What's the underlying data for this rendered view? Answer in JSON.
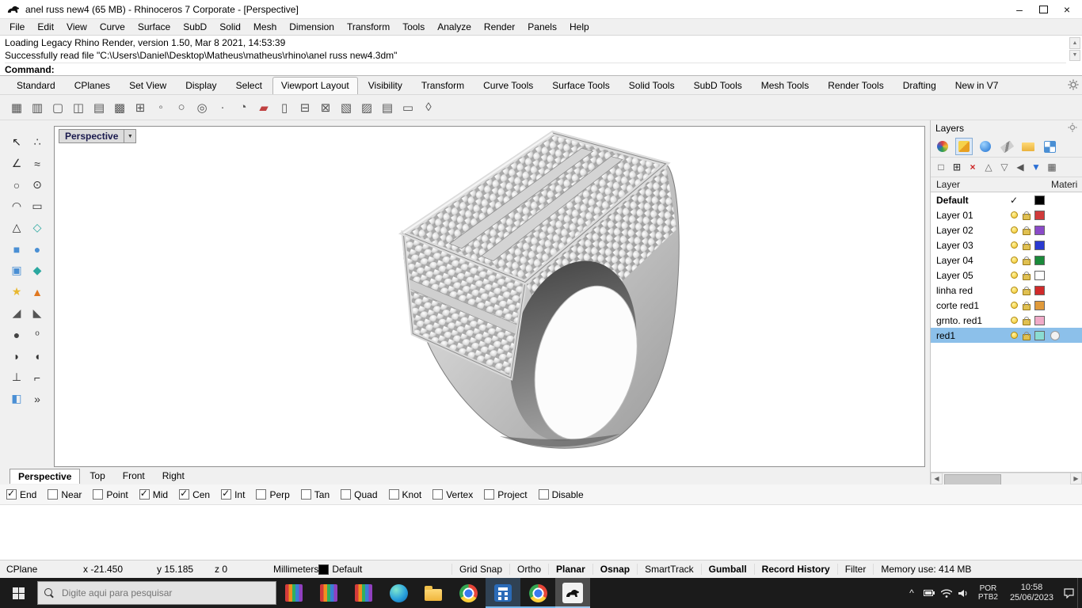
{
  "window": {
    "title": "anel russ new4 (65 MB) - Rhinoceros 7 Corporate - [Perspective]"
  },
  "menu": {
    "items": [
      "File",
      "Edit",
      "View",
      "Curve",
      "Surface",
      "SubD",
      "Solid",
      "Mesh",
      "Dimension",
      "Transform",
      "Tools",
      "Analyze",
      "Render",
      "Panels",
      "Help"
    ]
  },
  "command": {
    "history": [
      "Loading Legacy Rhino Render, version 1.50, Mar  8 2021, 14:53:39",
      "Successfully read file \"C:\\Users\\Daniel\\Desktop\\Matheus\\matheus\\rhino\\anel russ new4.3dm\""
    ],
    "prompt": "Command:"
  },
  "tabs": {
    "items": [
      {
        "label": "Standard"
      },
      {
        "label": "CPlanes"
      },
      {
        "label": "Set View"
      },
      {
        "label": "Display"
      },
      {
        "label": "Select"
      },
      {
        "label": "Viewport Layout",
        "cls": "active"
      },
      {
        "label": "Visibility"
      },
      {
        "label": "Transform"
      },
      {
        "label": "Curve Tools"
      },
      {
        "label": "Surface Tools"
      },
      {
        "label": "Solid Tools"
      },
      {
        "label": "SubD Tools"
      },
      {
        "label": "Mesh Tools"
      },
      {
        "label": "Render Tools"
      },
      {
        "label": "Drafting"
      },
      {
        "label": "New in V7"
      }
    ]
  },
  "toolbar": {
    "icons": [
      {
        "name": "four-viewports-icon",
        "glyph": "▦"
      },
      {
        "name": "viewport-layout-icon",
        "glyph": "▥"
      },
      {
        "name": "single-viewport-icon",
        "glyph": "▢"
      },
      {
        "name": "split-viewport-icon",
        "glyph": "◫"
      },
      {
        "name": "viewport-list-icon",
        "glyph": "▤"
      },
      {
        "name": "viewport-grid-icon",
        "glyph": "▩"
      },
      {
        "name": "new-viewport-icon",
        "glyph": "⊞"
      },
      {
        "name": "point-grid-icon",
        "glyph": "◦"
      },
      {
        "name": "circle-tool-icon",
        "glyph": "○"
      },
      {
        "name": "osnap-circle-icon",
        "glyph": "◎"
      },
      {
        "name": "dot-icon",
        "glyph": "·"
      },
      {
        "name": "shaded-display-icon",
        "glyph": "◔"
      },
      {
        "name": "color-swatch-icon",
        "glyph": "▰",
        "color": "#c04040"
      },
      {
        "name": "page-layout-icon",
        "glyph": "▯"
      },
      {
        "name": "section-view-icon",
        "glyph": "⊟"
      },
      {
        "name": "table-icon",
        "glyph": "⊠"
      },
      {
        "name": "hatch-icon",
        "glyph": "▧"
      },
      {
        "name": "ramp-icon",
        "glyph": "▨"
      },
      {
        "name": "printer-icon",
        "glyph": "▤"
      },
      {
        "name": "frame-icon",
        "glyph": "▭"
      },
      {
        "name": "lock-viewport-icon",
        "glyph": "◊"
      }
    ]
  },
  "tool_palette": {
    "tools": [
      {
        "name": "select-pointer-icon",
        "glyph": "↖",
        "color": "#222222"
      },
      {
        "name": "control-points-icon",
        "glyph": "∴",
        "color": "#444444"
      },
      {
        "name": "polyline-icon",
        "glyph": "∠",
        "color": "#333333"
      },
      {
        "name": "freeform-curve-icon",
        "glyph": "≈",
        "color": "#333333"
      },
      {
        "name": "circle-icon",
        "glyph": "○",
        "color": "#333333"
      },
      {
        "name": "ellipse-icon",
        "glyph": "⊙",
        "color": "#333333"
      },
      {
        "name": "arc-icon",
        "glyph": "◠",
        "color": "#333333"
      },
      {
        "name": "rectangle-icon",
        "glyph": "▭",
        "color": "#333333"
      },
      {
        "name": "polygon-icon",
        "glyph": "△",
        "color": "#333333"
      },
      {
        "name": "curve-tools-icon",
        "glyph": "◇",
        "color": "#2ba8a0"
      },
      {
        "name": "surface-icon",
        "glyph": "■",
        "color": "#4a8fd4"
      },
      {
        "name": "sphere-icon",
        "glyph": "●",
        "color": "#4a8fd4"
      },
      {
        "name": "box-icon",
        "glyph": "▣",
        "color": "#4a8fd4"
      },
      {
        "name": "solid-tools-icon",
        "glyph": "◆",
        "color": "#2ba8a0"
      },
      {
        "name": "explode-icon",
        "glyph": "★",
        "color": "#e8b830"
      },
      {
        "name": "fillet-icon",
        "glyph": "▲",
        "color": "#e07820"
      },
      {
        "name": "trim-icon",
        "glyph": "◢",
        "color": "#555555"
      },
      {
        "name": "split-icon",
        "glyph": "◣",
        "color": "#555555"
      },
      {
        "name": "shade-sphere-icon",
        "glyph": "●",
        "color": "#444444"
      },
      {
        "name": "point-cloud-icon",
        "glyph": "º",
        "color": "#555555"
      },
      {
        "name": "curve-boolean-icon",
        "glyph": "◗",
        "color": "#333333"
      },
      {
        "name": "arc-blend-icon",
        "glyph": "◖",
        "color": "#333333"
      },
      {
        "name": "cplane-icon",
        "glyph": "⊥",
        "color": "#333333"
      },
      {
        "name": "move-icon",
        "glyph": "⌐",
        "color": "#333333"
      },
      {
        "name": "gumball-icon",
        "glyph": "◧",
        "color": "#4a8fd4"
      },
      {
        "name": "more-tools-chevron-icon",
        "glyph": "»",
        "color": "#333333"
      }
    ]
  },
  "viewport": {
    "label": "Perspective",
    "tabs": [
      {
        "label": "Perspective",
        "cls": "active"
      },
      {
        "label": "Top"
      },
      {
        "label": "Front"
      },
      {
        "label": "Right"
      }
    ]
  },
  "layers_panel": {
    "title": "Layers",
    "columns": {
      "layer": "Layer",
      "material": "Materi"
    },
    "panel_tabs": [
      {
        "name": "properties-icon",
        "kind": "pt-ball"
      },
      {
        "name": "layers-tab-icon",
        "kind": "pt-layers",
        "cls": "active"
      },
      {
        "name": "display-icon",
        "kind": "pt-display"
      },
      {
        "name": "match-properties-icon",
        "kind": "pt-match"
      },
      {
        "name": "libraries-icon",
        "kind": "pt-folder"
      },
      {
        "name": "rendering-icon",
        "kind": "pt-render"
      }
    ],
    "tools": [
      {
        "name": "new-layer-icon",
        "glyph": "□",
        "color": "#444444"
      },
      {
        "name": "new-sublayer-icon",
        "glyph": "⊞",
        "color": "#444444"
      },
      {
        "name": "delete-layer-icon",
        "glyph": "×",
        "color": "#cc2222"
      },
      {
        "name": "move-up-icon",
        "glyph": "△",
        "color": "#666666"
      },
      {
        "name": "move-down-icon",
        "glyph": "▽",
        "color": "#666666"
      },
      {
        "name": "collapse-all-icon",
        "glyph": "◀",
        "color": "#555555"
      },
      {
        "name": "filter-icon",
        "glyph": "▼",
        "color": "#2a6fd4"
      },
      {
        "name": "layer-tools-icon",
        "glyph": "▦",
        "color": "#555555"
      }
    ],
    "layers": [
      {
        "name": "Default",
        "ncls": "bold",
        "current": true,
        "color": "#000000"
      },
      {
        "name": "Layer 01",
        "bulb": true,
        "lock": true,
        "color": "#d03a3a"
      },
      {
        "name": "Layer 02",
        "bulb": true,
        "lock": true,
        "color": "#8a4ac8"
      },
      {
        "name": "Layer 03",
        "bulb": true,
        "lock": true,
        "color": "#2a3ad0"
      },
      {
        "name": "Layer 04",
        "bulb": true,
        "lock": true,
        "color": "#1a8a3a"
      },
      {
        "name": "Layer 05",
        "bulb": true,
        "lock": true,
        "color": "#ffffff"
      },
      {
        "name": "linha red",
        "bulb": true,
        "lock": true,
        "color": "#d02a2a"
      },
      {
        "name": "corte red1",
        "bulb": true,
        "lock": true,
        "color": "#e09a3a"
      },
      {
        "name": "grnto. red1",
        "bulb": true,
        "lock": true,
        "color": "#f0aac8"
      },
      {
        "name": "red1",
        "cls": "selected",
        "bulb": true,
        "lock": true,
        "color": "#8adcd2",
        "material": "#f2f2f2"
      }
    ]
  },
  "osnap": {
    "items": [
      {
        "label": "End",
        "state": "checked"
      },
      {
        "label": "Near"
      },
      {
        "label": "Point"
      },
      {
        "label": "Mid",
        "state": "checked"
      },
      {
        "label": "Cen",
        "state": "checked"
      },
      {
        "label": "Int",
        "state": "checked"
      },
      {
        "label": "Perp"
      },
      {
        "label": "Tan"
      },
      {
        "label": "Quad"
      },
      {
        "label": "Knot"
      },
      {
        "label": "Vertex"
      },
      {
        "label": "Project"
      },
      {
        "label": "Disable"
      }
    ]
  },
  "status_bar": {
    "left": [
      {
        "label": "CPlane"
      },
      {
        "label": "x -21.450"
      },
      {
        "label": "y 15.185"
      },
      {
        "label": "z 0"
      },
      {
        "label": "Millimeters"
      },
      {
        "label": "Default",
        "swatch": true
      }
    ],
    "toggles": [
      {
        "label": "Grid Snap"
      },
      {
        "label": "Ortho"
      },
      {
        "label": "Planar",
        "cls": "bold"
      },
      {
        "label": "Osnap",
        "cls": "bold"
      },
      {
        "label": "SmartTrack"
      },
      {
        "label": "Gumball",
        "cls": "bold"
      },
      {
        "label": "Record History",
        "cls": "bold"
      },
      {
        "label": "Filter"
      },
      {
        "label": "Memory use: 414 MB"
      }
    ]
  },
  "taskbar": {
    "search_placeholder": "Digite aqui para pesquisar",
    "language": "POR",
    "keyboard_layout": "PTB2",
    "time": "10:58",
    "date": "25/06/2023"
  }
}
